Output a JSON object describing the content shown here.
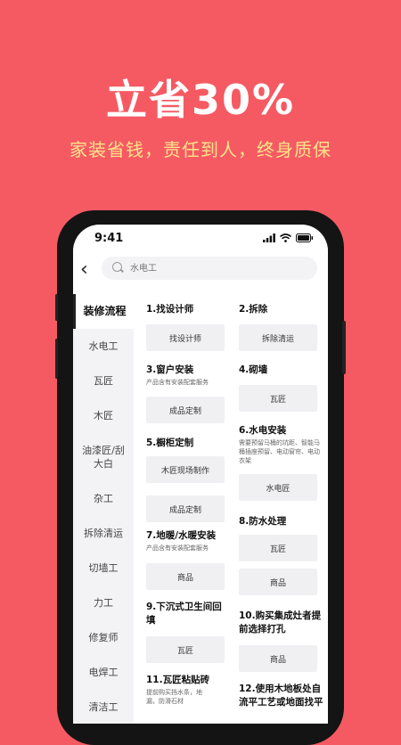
{
  "promo": {
    "headline": "立省30%",
    "subline": "家装省钱，责任到人，终身质保"
  },
  "status_bar": {
    "time": "9:41"
  },
  "search": {
    "placeholder": "水电工"
  },
  "sidebar": {
    "items": [
      {
        "label": "装修流程",
        "active": true
      },
      {
        "label": "水电工"
      },
      {
        "label": "瓦匠"
      },
      {
        "label": "木匠"
      },
      {
        "label": "油漆匠/刮大白"
      },
      {
        "label": "杂工"
      },
      {
        "label": "拆除清运"
      },
      {
        "label": "切墙工"
      },
      {
        "label": "力工"
      },
      {
        "label": "修复师"
      },
      {
        "label": "电焊工"
      },
      {
        "label": "清洁工"
      }
    ]
  },
  "steps": {
    "s1": {
      "title": "1.找设计师",
      "tags": [
        "找设计师"
      ]
    },
    "s2": {
      "title": "2.拆除",
      "tags": [
        "拆除清运"
      ]
    },
    "s3": {
      "title": "3.窗户安装",
      "note": "产品含有安装配套服务",
      "tags": [
        "成品定制"
      ]
    },
    "s4": {
      "title": "4.砌墙",
      "tags": [
        "瓦匠"
      ]
    },
    "s5": {
      "title": "5.橱柜定制",
      "tags": [
        "木匠现场制作",
        "成品定制"
      ]
    },
    "s6": {
      "title": "6.水电安装",
      "note": "需要预留马桶的坑距、智能马桶插座预留、电动窗帘、电动衣架",
      "tags": [
        "水电匠"
      ]
    },
    "s7": {
      "title": "7.地暖/水暖安装",
      "note": "产品含有安装配套服务",
      "tags": [
        "商品"
      ]
    },
    "s8": {
      "title": "8.防水处理",
      "tags": [
        "瓦匠",
        "商品"
      ]
    },
    "s9": {
      "title": "9.下沉式卫生间回填",
      "tags": [
        "瓦匠"
      ]
    },
    "s10": {
      "title": "10.购买集成灶者提前选择打孔",
      "tags": [
        "商品"
      ]
    },
    "s11": {
      "title": "11.瓦匠粘贴砖",
      "note": "提前购买挡水条，地漏，防滑石材"
    },
    "s12": {
      "title": "12.使用木地板处自流平工艺或地面找平"
    }
  },
  "colors": {
    "background": "#F55A63",
    "subline": "#FFE48A"
  }
}
